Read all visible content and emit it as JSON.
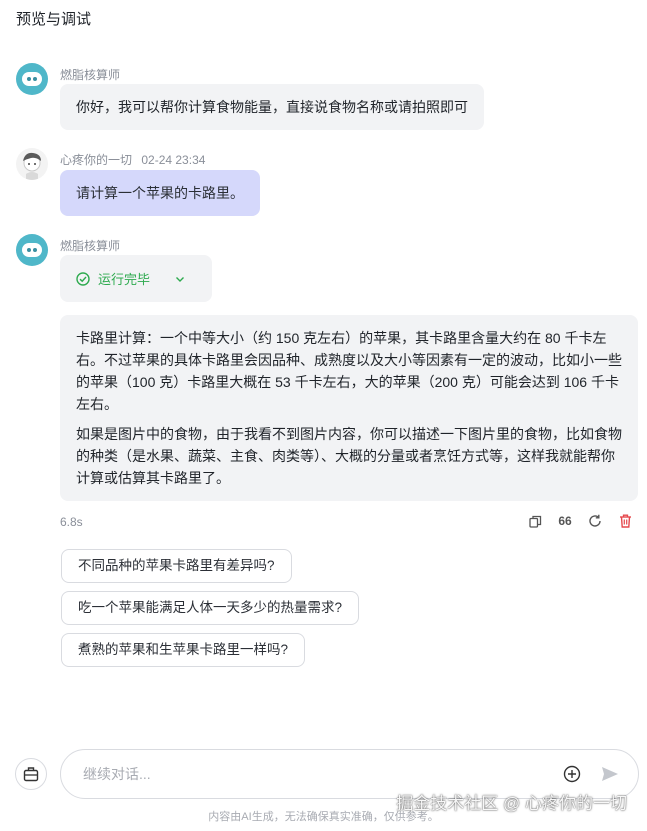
{
  "header": {
    "title": "预览与调试"
  },
  "messages": [
    {
      "sender": "燃脂核算师",
      "text": "你好，我可以帮你计算食物能量，直接说食物名称或请拍照即可"
    },
    {
      "sender": "心疼你的一切",
      "time": "02-24 23:34",
      "text": "请计算一个苹果的卡路里。"
    },
    {
      "sender": "燃脂核算师",
      "status": "运行完毕",
      "paragraphs": [
        "卡路里计算：一个中等大小（约 150 克左右）的苹果，其卡路里含量大约在 80 千卡左右。不过苹果的具体卡路里会因品种、成熟度以及大小等因素有一定的波动，比如小一些的苹果（100 克）卡路里大概在 53 千卡左右，大的苹果（200 克）可能会达到 106 千卡左右。",
        "如果是图片中的食物，由于我看不到图片内容，你可以描述一下图片里的食物，比如食物的种类（是水果、蔬菜、主食、肉类等）、大概的分量或者烹饪方式等，这样我就能帮你计算或估算其卡路里了。"
      ],
      "duration": "6.8s",
      "quote_glyph": "66"
    }
  ],
  "suggestions": [
    "不同品种的苹果卡路里有差异吗?",
    "吃一个苹果能满足人体一天多少的热量需求?",
    "煮熟的苹果和生苹果卡路里一样吗?"
  ],
  "input": {
    "placeholder": "继续对话..."
  },
  "footer": {
    "disclaimer": "内容由AI生成，无法确保真实准确，仅供参考。",
    "watermark": "掘金技术社区 @ 心疼你的一切"
  },
  "colors": {
    "accent": "#d5d8fb",
    "bot_avatar": "#4fb7c9",
    "success": "#2eaa4f",
    "danger": "#e5484d"
  },
  "icons": [
    "robot-icon",
    "check-circle-icon",
    "chevron-down-icon",
    "copy-icon",
    "quote-icon",
    "refresh-icon",
    "trash-icon",
    "toolbox-icon",
    "plus-circle-icon",
    "send-icon"
  ]
}
